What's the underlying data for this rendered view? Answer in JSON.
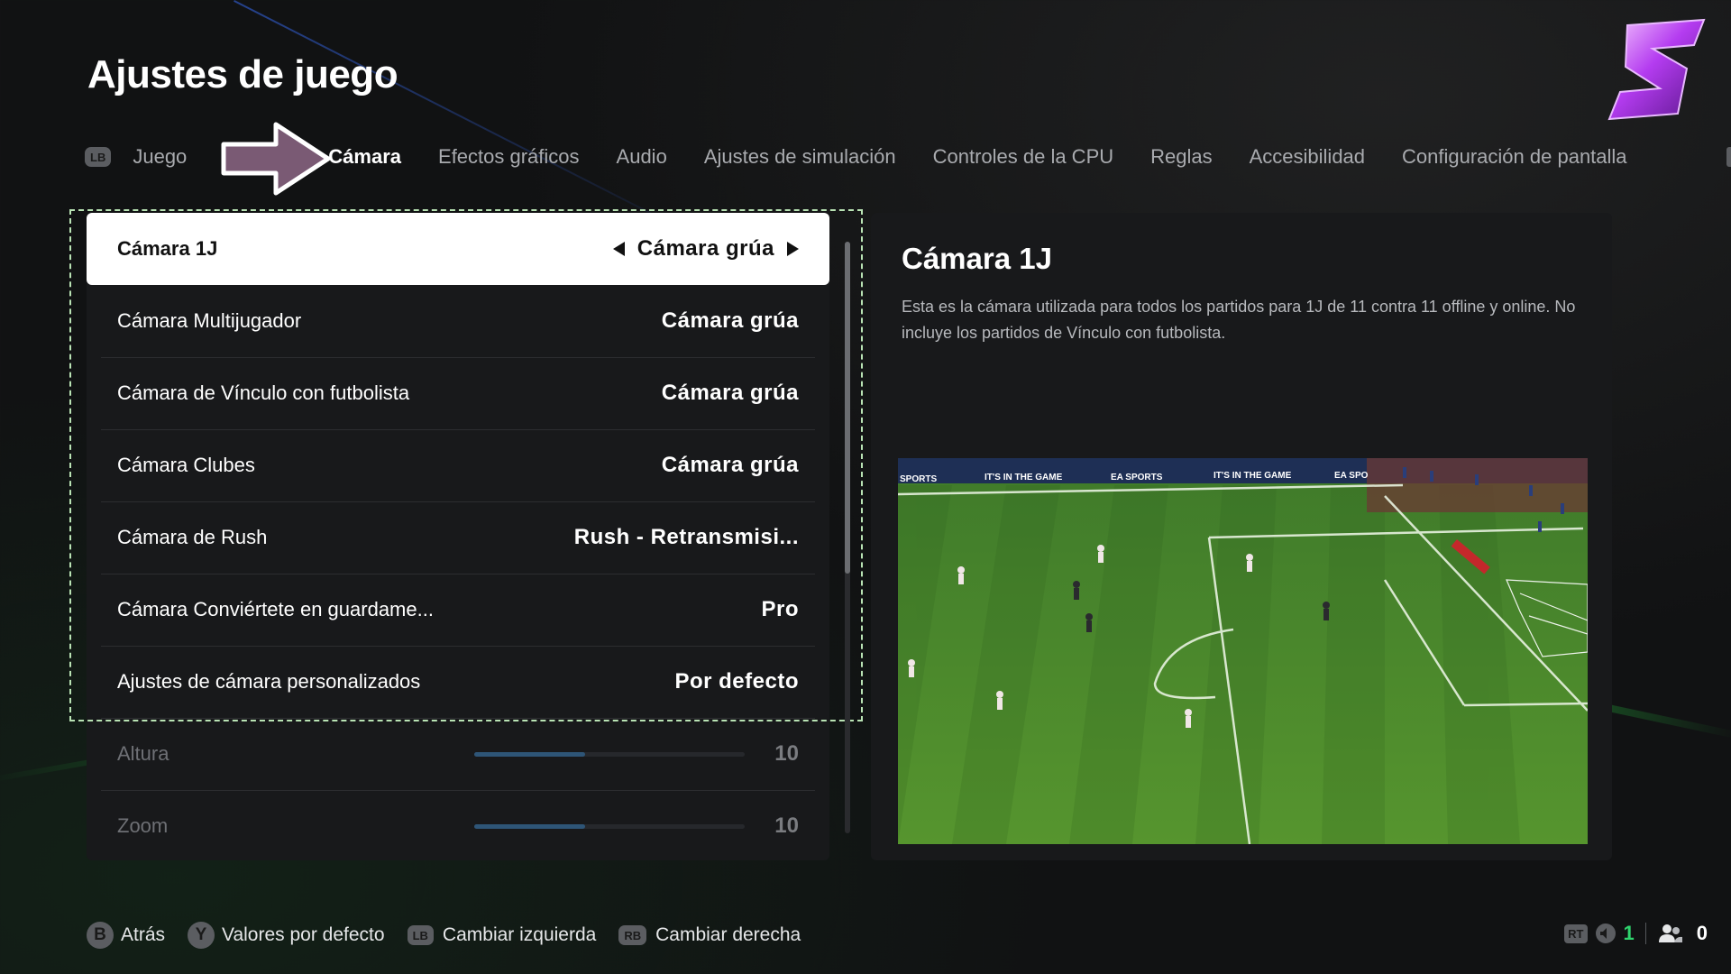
{
  "page": {
    "title": "Ajustes de juego"
  },
  "tabs": {
    "left_button": "LB",
    "items": [
      {
        "label": "Juego",
        "active": false
      },
      {
        "label": "Cámara",
        "active": true
      },
      {
        "label": "Efectos gráficos",
        "active": false
      },
      {
        "label": "Audio",
        "active": false
      },
      {
        "label": "Ajustes de simulación",
        "active": false
      },
      {
        "label": "Controles de la CPU",
        "active": false
      },
      {
        "label": "Reglas",
        "active": false
      },
      {
        "label": "Accesibilidad",
        "active": false
      },
      {
        "label": "Configuración de pantalla",
        "active": false
      }
    ]
  },
  "settings": [
    {
      "label": "Cámara 1J",
      "value": "Cámara grúa",
      "selected": true
    },
    {
      "label": "Cámara Multijugador",
      "value": "Cámara grúa"
    },
    {
      "label": "Cámara de Vínculo con futbolista",
      "value": "Cámara grúa"
    },
    {
      "label": "Cámara Clubes",
      "value": "Cámara grúa"
    },
    {
      "label": "Cámara de Rush",
      "value": "Rush - Retransmisi..."
    },
    {
      "label": "Cámara Conviértete en guardame...",
      "value": "Pro"
    },
    {
      "label": "Ajustes de cámara personalizados",
      "value": "Por defecto"
    }
  ],
  "sliders": [
    {
      "label": "Altura",
      "value": "10",
      "fill_fraction": 0.41
    },
    {
      "label": "Zoom",
      "value": "10",
      "fill_fraction": 0.41
    }
  ],
  "info": {
    "title": "Cámara 1J",
    "description": "Esta es la cámara utilizada para todos los partidos para 1J de 11 contra 11 offline y online. No incluye los partidos de Vínculo con futbolista."
  },
  "footer": {
    "back_button": "B",
    "back_label": "Atrás",
    "defaults_button": "Y",
    "defaults_label": "Valores por defecto",
    "left_button": "LB",
    "left_label": "Cambiar izquierda",
    "right_button": "RB",
    "right_label": "Cambiar derecha"
  },
  "status": {
    "rt_label": "RT",
    "players_count": "1",
    "party_count": "0"
  },
  "preview": {
    "boards": [
      "SPORTS",
      "IT'S IN THE GAME",
      "EA SPORTS",
      "IT'S IN THE GAME",
      "EA SPO"
    ]
  },
  "colors": {
    "background": "#111213",
    "panel": "#18191b",
    "selected_row": "#ffffff",
    "focus_outline": "#b9e3b4",
    "slider_fill": "#2e5577",
    "status_green": "#2fd36d",
    "logo_purple": "#b43cf0"
  }
}
